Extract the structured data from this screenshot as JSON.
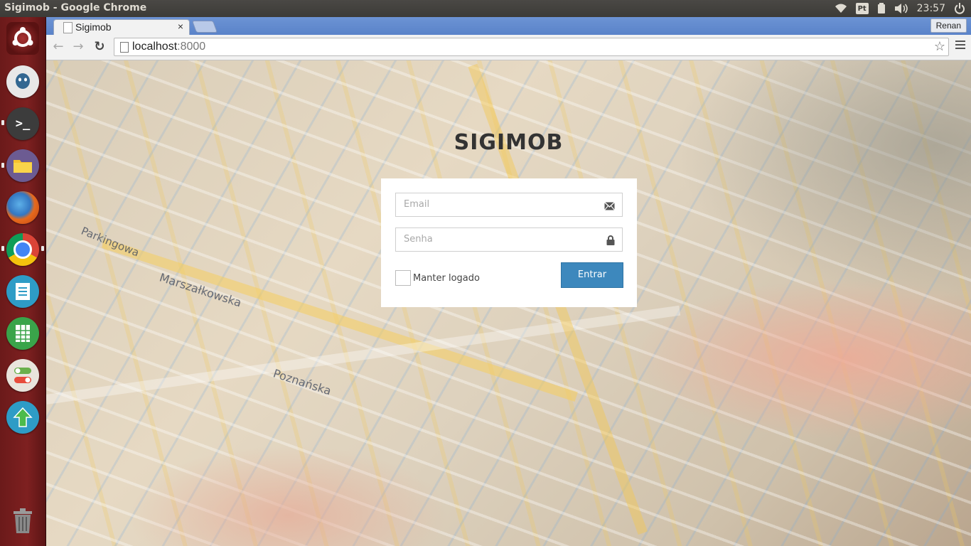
{
  "os": {
    "window_title": "Sigimob - Google Chrome",
    "keyboard_layout": "Pt",
    "clock": "23:57",
    "launcher_items": [
      "ubuntu-dash",
      "pgadmin",
      "terminal",
      "files",
      "firefox",
      "chrome",
      "writer",
      "calc",
      "settings",
      "update-manager",
      "trash"
    ]
  },
  "browser": {
    "tab_title": "Sigimob",
    "tab_close": "×",
    "profile_name": "Renan",
    "url_host": "localhost",
    "url_port": ":8000"
  },
  "page": {
    "title": "SIGIMOB",
    "email_placeholder": "Email",
    "password_placeholder": "Senha",
    "remember_label": "Manter logado",
    "submit_label": "Entrar",
    "accent_color": "#3d88bd"
  }
}
